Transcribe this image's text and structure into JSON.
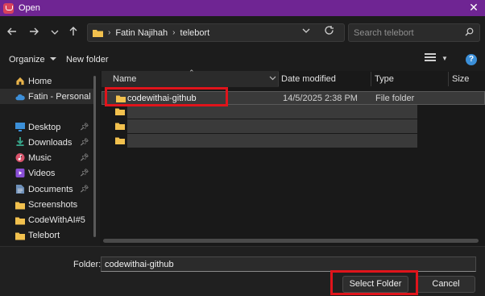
{
  "window": {
    "title": "Open",
    "close_glyph": "✕"
  },
  "nav": {
    "back_icon": "arrow-left-icon",
    "forward_icon": "arrow-right-icon",
    "recent_icon": "chevron-down-icon",
    "up_icon": "arrow-up-icon"
  },
  "address": {
    "crumbs": [
      "Fatin Najihah",
      "telebort"
    ]
  },
  "search": {
    "placeholder": "Search telebort"
  },
  "toolbar": {
    "organize": "Organize",
    "new_folder": "New folder",
    "help": "?"
  },
  "sidebar": {
    "items": [
      {
        "label": "Home",
        "icon": "home-icon",
        "pinned": false
      },
      {
        "label": "Fatin - Personal",
        "icon": "cloud-icon",
        "pinned": false,
        "selected": true
      },
      {
        "label": "Desktop",
        "icon": "desktop-icon",
        "pinned": true
      },
      {
        "label": "Downloads",
        "icon": "download-icon",
        "pinned": true
      },
      {
        "label": "Music",
        "icon": "music-icon",
        "pinned": true
      },
      {
        "label": "Videos",
        "icon": "video-icon",
        "pinned": true
      },
      {
        "label": "Documents",
        "icon": "documents-icon",
        "pinned": true
      },
      {
        "label": "Screenshots",
        "icon": "folder-icon",
        "pinned": false
      },
      {
        "label": "CodeWithAI#5",
        "icon": "folder-icon",
        "pinned": false
      },
      {
        "label": "Telebort",
        "icon": "folder-icon",
        "pinned": false
      }
    ]
  },
  "table": {
    "columns": {
      "name": "Name",
      "date": "Date modified",
      "type": "Type",
      "size": "Size"
    },
    "rows": [
      {
        "name": "codewithai-github",
        "date": "14/5/2025 2:38 PM",
        "type": "File folder",
        "selected": true
      },
      {
        "name": "",
        "date": "",
        "type": "",
        "redacted": true
      },
      {
        "name": "",
        "date": "",
        "type": "",
        "redacted": true
      },
      {
        "name": "",
        "date": "",
        "type": "",
        "redacted": true
      }
    ]
  },
  "footer": {
    "folder_label": "Folder:",
    "folder_value": "codewithai-github",
    "select_button": "Select Folder",
    "cancel_button": "Cancel"
  },
  "colors": {
    "titlebar": "#6f2593",
    "highlight": "#e0141b",
    "folder": "#f2c14e"
  }
}
